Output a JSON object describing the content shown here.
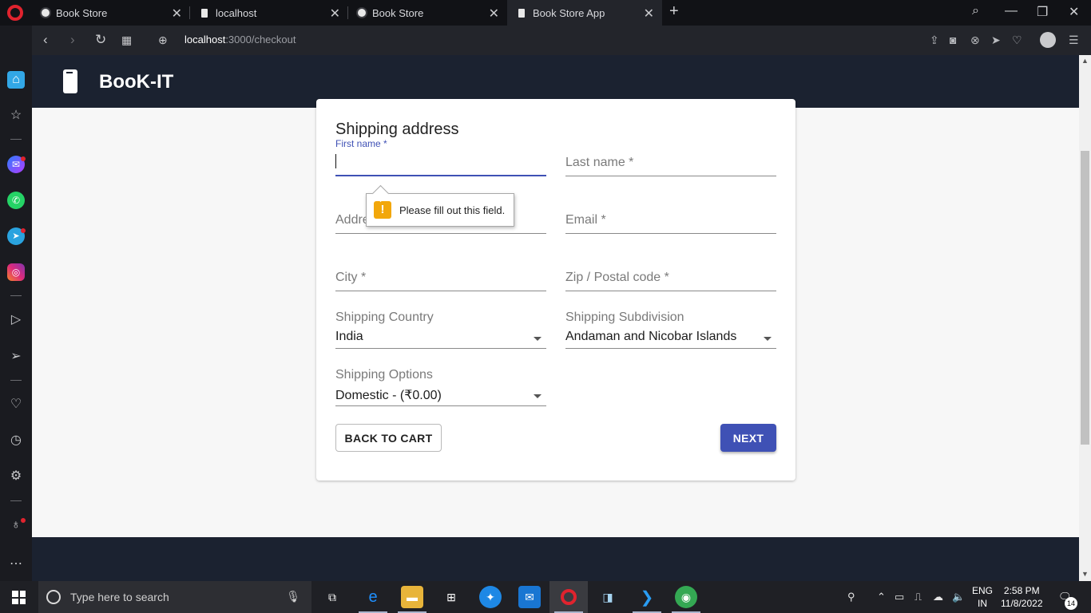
{
  "browser": {
    "tabs": [
      {
        "label": "Book Store"
      },
      {
        "label": "localhost"
      },
      {
        "label": "Book Store"
      },
      {
        "label": "Book Store App"
      }
    ],
    "url_host": "localhost",
    "url_rest": ":3000/checkout"
  },
  "app": {
    "brand": "BooK-IT"
  },
  "form": {
    "title": "Shipping address",
    "first_name_label": "First name *",
    "last_name_label": "Last name *",
    "address_label": "Address line 1 *",
    "email_label": "Email *",
    "city_label": "City *",
    "zip_label": "Zip / Postal code *",
    "country_label": "Shipping Country",
    "country_value": "India",
    "subdivision_label": "Shipping Subdivision",
    "subdivision_value": "Andaman and Nicobar Islands",
    "options_label": "Shipping Options",
    "options_value": "Domestic - (₹0.00)",
    "back_button": "BACK TO CART",
    "next_button": "NEXT",
    "validation_message": "Please fill out this field."
  },
  "taskbar": {
    "search_placeholder": "Type here to search",
    "language_line1": "ENG",
    "language_line2": "IN",
    "time": "2:58 PM",
    "date": "11/8/2022",
    "notification_count": "14"
  },
  "colors": {
    "primary": "#3f51b5",
    "app_bar": "#1b2230",
    "warning": "#f2a70b",
    "opera_red": "#e0232e"
  }
}
